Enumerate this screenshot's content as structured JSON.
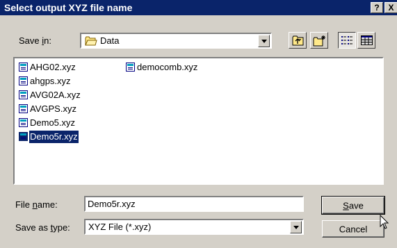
{
  "window": {
    "title": "Select output XYZ file name",
    "help_label": "?",
    "close_label": "X"
  },
  "save_in": {
    "label_pre": "Save ",
    "label_key": "i",
    "label_post": "n:",
    "value": "Data"
  },
  "toolbar": {
    "up_folder_icon": "up-folder-icon",
    "new_folder_icon": "new-folder-icon",
    "list_view_icon": "list-view-icon",
    "details_view_icon": "details-view-icon"
  },
  "files": {
    "col1": [
      "AHG02.xyz",
      "ahgps.xyz",
      "AVG02A.xyz",
      "AVGPS.xyz",
      "Demo5.xyz",
      "Demo5r.xyz"
    ],
    "col2": [
      "democomb.xyz"
    ],
    "selected": "Demo5r.xyz"
  },
  "file_name": {
    "label_pre": "File ",
    "label_key": "n",
    "label_post": "ame:",
    "value": "Demo5r.xyz"
  },
  "save_as_type": {
    "label_pre": "Save as ",
    "label_key": "t",
    "label_post": "ype:",
    "value": "XYZ File (*.xyz)"
  },
  "buttons": {
    "save_key": "S",
    "save_rest": "ave",
    "cancel": "Cancel"
  },
  "colors": {
    "titlebar": "#0a246a",
    "face": "#d4d0c8",
    "selection": "#0a246a"
  }
}
